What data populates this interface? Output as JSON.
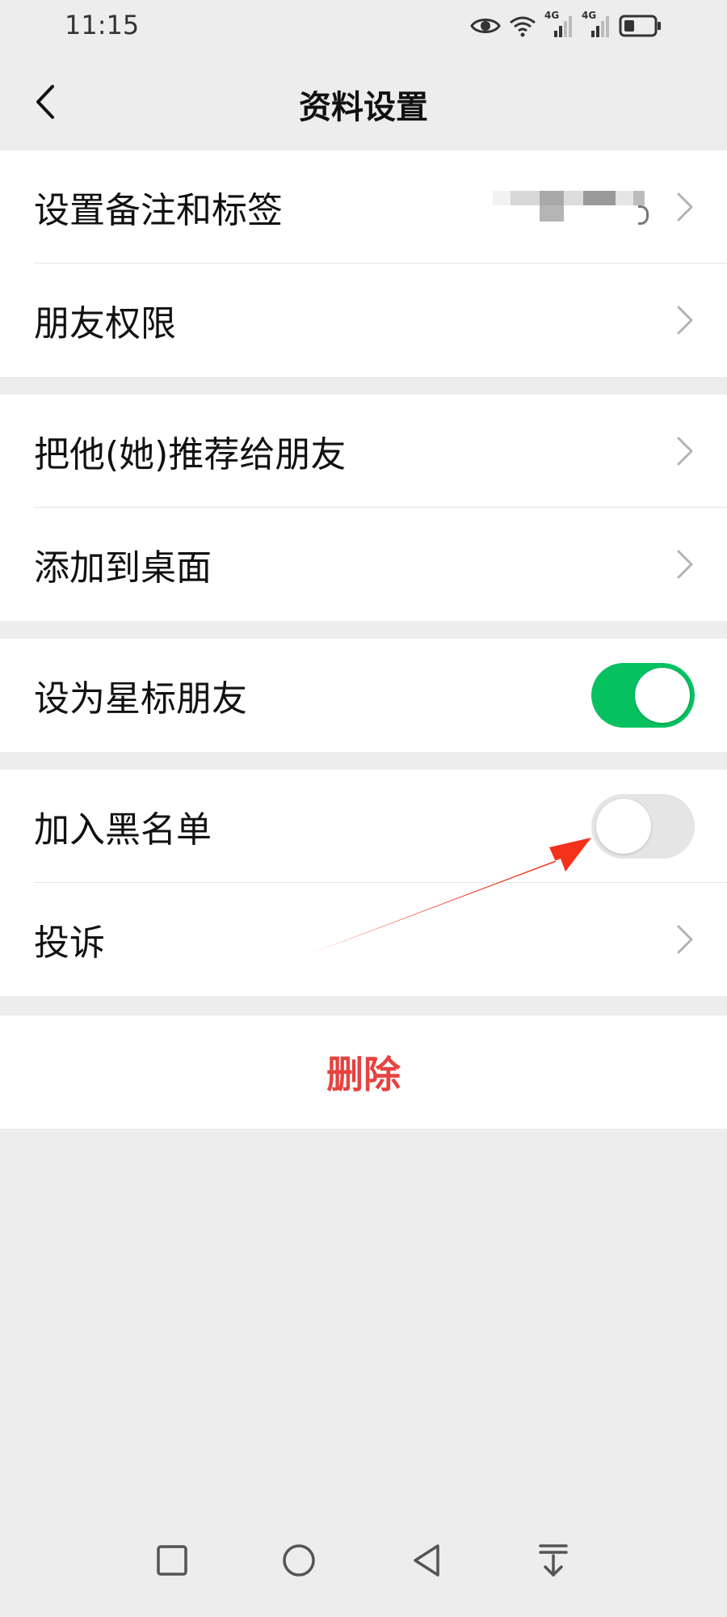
{
  "status_bar": {
    "time": "11:15",
    "icons": [
      "eye-icon",
      "wifi-icon",
      "signal-4g-icon",
      "signal-4g-icon",
      "battery-icon"
    ],
    "network_label_1": "4G",
    "network_label_2": "4G"
  },
  "header": {
    "title": "资料设置",
    "back_icon": "chevron-left-icon"
  },
  "groups": [
    {
      "rows": [
        {
          "label": "设置备注和标签",
          "type": "link",
          "value_blurred": true
        },
        {
          "label": "朋友权限",
          "type": "link"
        }
      ]
    },
    {
      "rows": [
        {
          "label": "把他(她)推荐给朋友",
          "type": "link"
        },
        {
          "label": "添加到桌面",
          "type": "link"
        }
      ]
    },
    {
      "rows": [
        {
          "label": "设为星标朋友",
          "type": "toggle",
          "state": "on"
        }
      ]
    },
    {
      "rows": [
        {
          "label": "加入黑名单",
          "type": "toggle",
          "state": "off"
        },
        {
          "label": "投诉",
          "type": "link"
        }
      ]
    }
  ],
  "delete_label": "删除",
  "colors": {
    "background": "#ededed",
    "toggle_on": "#07c160",
    "toggle_off": "#e5e5e5",
    "delete": "#e64340",
    "annotation_arrow": "#f5311c"
  },
  "system_nav": [
    "square-icon",
    "circle-icon",
    "triangle-back-icon",
    "pull-down-icon"
  ]
}
